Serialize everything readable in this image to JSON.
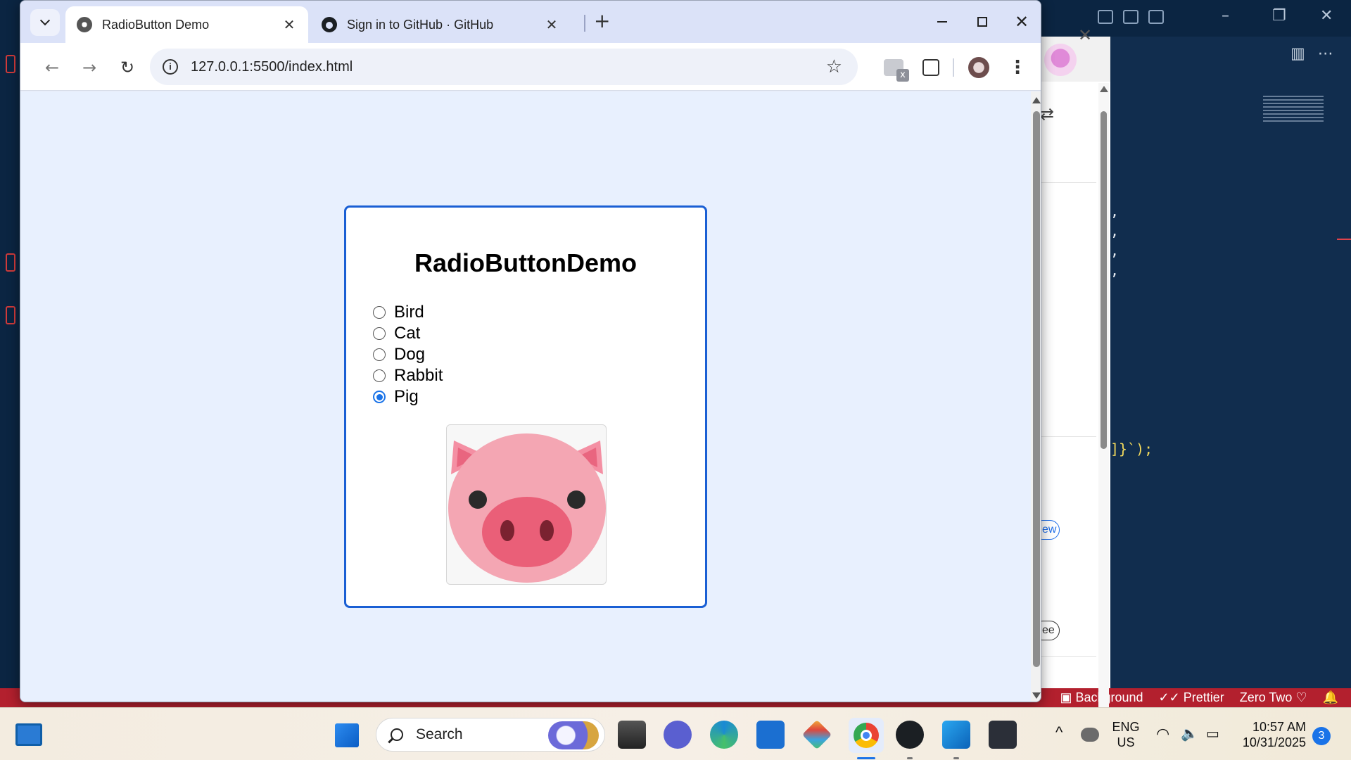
{
  "browser": {
    "tabs": [
      {
        "title": "RadioButton Demo",
        "active": true
      },
      {
        "title": "Sign in to GitHub · GitHub",
        "active": false
      }
    ],
    "address": "127.0.0.1:5500/index.html"
  },
  "page": {
    "heading": "RadioButtonDemo",
    "options": [
      {
        "label": "Bird",
        "checked": false
      },
      {
        "label": "Cat",
        "checked": false
      },
      {
        "label": "Dog",
        "checked": false
      },
      {
        "label": "Rabbit",
        "checked": false
      },
      {
        "label": "Pig",
        "checked": true
      }
    ],
    "image_subject": "pig-face-emoji"
  },
  "vscode": {
    "code_lines": [
      ",",
      ",",
      ",",
      ",",
      "]}`);"
    ],
    "status_items": [
      "Background",
      "Prettier",
      "Zero Two"
    ],
    "side_panel": {
      "pill_1": "ew",
      "pill_2": "ee"
    }
  },
  "taskbar": {
    "search_placeholder": "Search",
    "lang_top": "ENG",
    "lang_bottom": "US",
    "time": "10:57 AM",
    "date": "10/31/2025",
    "notification_count": "3"
  },
  "colors": {
    "accent": "#1a5fd4",
    "radio_checked": "#1a73e8",
    "page_bg": "#e8f0fe",
    "vscode_status": "#b3202e"
  }
}
